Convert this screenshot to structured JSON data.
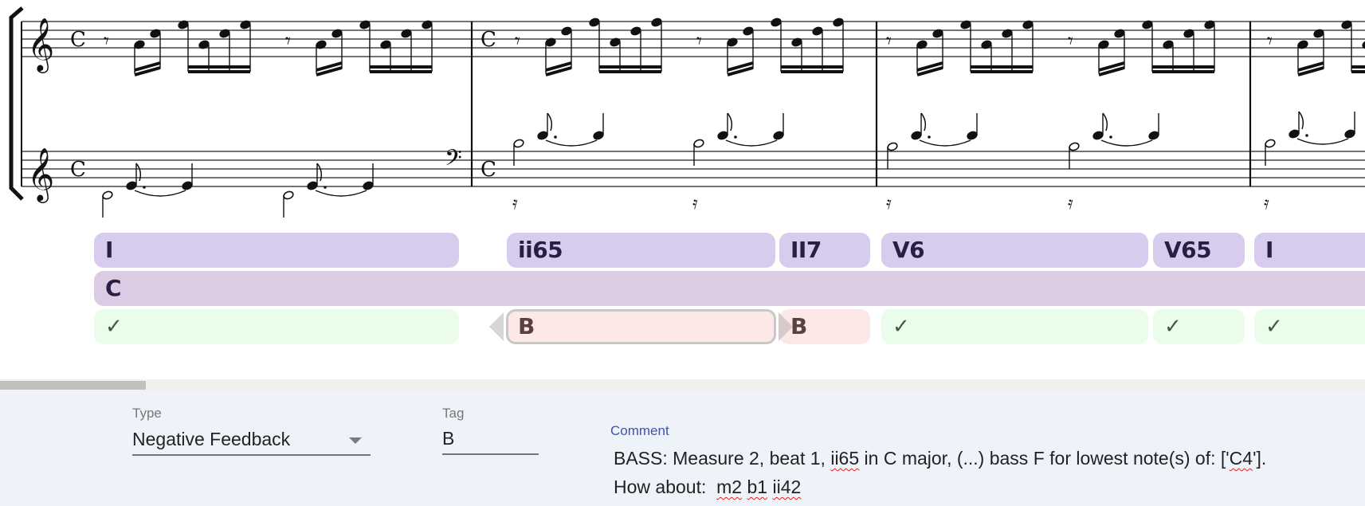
{
  "score": {
    "systems": [
      {
        "staff": "treble",
        "clef": "treble-clef",
        "time_signature": "C"
      },
      {
        "staff": "lower",
        "clef_start": "treble-clef",
        "clef_change": "bass-clef",
        "time_signature": "C"
      }
    ],
    "measures_visible": 4,
    "upper_pattern": [
      "eighth-rest",
      "sixteenth",
      "sixteenth",
      "sixteenth",
      "sixteenth",
      "sixteenth",
      "sixteenth"
    ],
    "lower_pattern": [
      "half-note",
      "dotted-eighth",
      "quarter-note"
    ]
  },
  "analysis": {
    "chords": [
      {
        "label": "I"
      },
      {
        "label": "ii65"
      },
      {
        "label": "II7"
      },
      {
        "label": "V6"
      },
      {
        "label": "V65"
      },
      {
        "label": "I"
      }
    ],
    "key": {
      "label": "C"
    },
    "feedback": [
      {
        "label": "✓",
        "status": "ok"
      },
      {
        "label": "B",
        "status": "negative",
        "selected": true
      },
      {
        "label": "B",
        "status": "negative"
      },
      {
        "label": "✓",
        "status": "ok"
      },
      {
        "label": "✓",
        "status": "ok"
      },
      {
        "label": "✓",
        "status": "ok"
      }
    ]
  },
  "scrollbar": {
    "position_fraction": 0.0,
    "thumb_fraction": 0.107
  },
  "form": {
    "type_label": "Type",
    "type_value": "Negative Feedback",
    "tag_label": "Tag",
    "tag_value": "B",
    "comment_label": "Comment",
    "comment_line1": {
      "a": "BASS: Measure 2, beat 1, ",
      "b": "ii65",
      "c": " in C major, (...) bass F for lowest note(s) of: ['",
      "d": "C4",
      "e": "']."
    },
    "comment_line2": {
      "a": "How about:  ",
      "b": "m2",
      "c": " ",
      "d": "b1",
      "e": " ",
      "f": "ii42"
    }
  },
  "colors": {
    "chord_bg": "#d8ccee",
    "key_bg": "#dbcce4",
    "ok_bg": "#eafdea",
    "negative_bg": "#fde8e8",
    "panel_bg": "#eef3fa",
    "comment_label": "#3f51b5"
  }
}
